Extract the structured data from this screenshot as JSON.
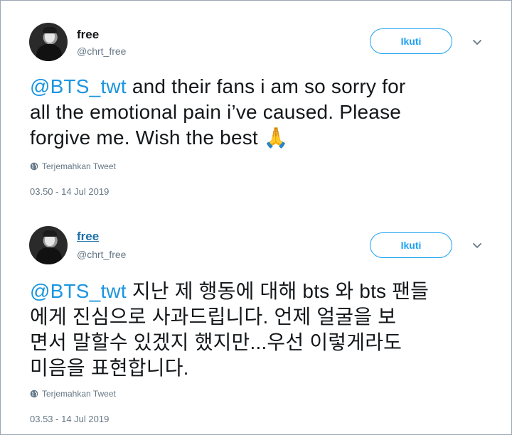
{
  "tweets": [
    {
      "name": "free",
      "handle": "@chrt_free",
      "follow_label": "Ikuti",
      "mention": "@BTS_twt",
      "text_line1_after_mention": " and their fans i am so sorry for",
      "text_line2": "all the emotional pain i’ve caused. Please",
      "text_line3": "forgive me. Wish the best ",
      "emoji": "🙏",
      "translate_label": "Terjemahkan Tweet",
      "timestamp": "03.50 - 14 Jul 2019"
    },
    {
      "name": "free",
      "handle": "@chrt_free",
      "follow_label": "Ikuti",
      "mention": "@BTS_twt",
      "text_line1_after_mention": " 지난 제 행동에 대해 bts 와 bts 팬들",
      "text_line2": "에게 진심으로 사과드립니다. 언제 얼굴을 보",
      "text_line3": "면서 말할수 있겠지 했지만...우선 이렇게라도",
      "text_line4": "미음을 표현합니다.",
      "translate_label": "Terjemahkan Tweet",
      "timestamp": "03.53 - 14 Jul 2019"
    }
  ],
  "colors": {
    "accent": "#1da1f2",
    "mention": "#1b95e0",
    "muted": "#657786",
    "text": "#14171a"
  },
  "icons": [
    "avatar-photo",
    "chevron-down-icon",
    "globe-icon",
    "folded-hands-emoji"
  ]
}
